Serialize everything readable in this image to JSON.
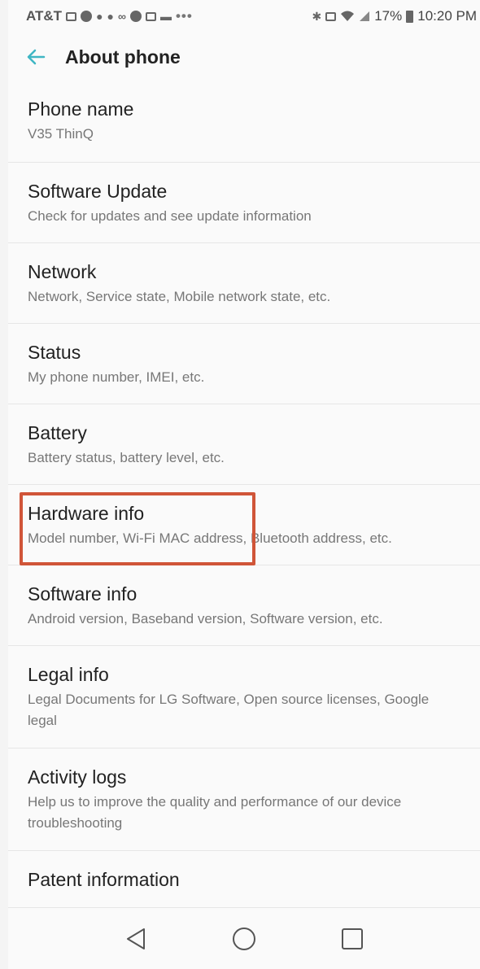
{
  "status_bar": {
    "carrier": "AT&T",
    "battery_percent": "17%",
    "time": "10:20 PM",
    "icons": [
      "message-icon",
      "whatsapp-icon",
      "app-icon",
      "app-icon",
      "voicemail-icon",
      "chrome-icon",
      "gallery-icon",
      "app-icon",
      "more-dots",
      "bluetooth-icon",
      "nfc-icon",
      "wifi-icon",
      "signal-icon",
      "battery-icon"
    ]
  },
  "header": {
    "title": "About phone"
  },
  "items": [
    {
      "title": "Phone name",
      "subtitle": "V35 ThinQ"
    },
    {
      "title": "Software Update",
      "subtitle": "Check for updates and see update information"
    },
    {
      "title": "Network",
      "subtitle": "Network, Service state, Mobile network state, etc."
    },
    {
      "title": "Status",
      "subtitle": "My phone number, IMEI, etc."
    },
    {
      "title": "Battery",
      "subtitle": "Battery status, battery level, etc."
    },
    {
      "title": "Hardware info",
      "subtitle": "Model number, Wi-Fi MAC address, Bluetooth address, etc."
    },
    {
      "title": "Software info",
      "subtitle": "Android version, Baseband version, Software version, etc."
    },
    {
      "title": "Legal info",
      "subtitle": "Legal Documents for LG Software, Open source licenses, Google legal"
    },
    {
      "title": "Activity logs",
      "subtitle": "Help us to improve the quality and performance of our device troubleshooting"
    },
    {
      "title": "Patent information",
      "subtitle": ""
    }
  ],
  "highlighted_item": "Hardware info",
  "colors": {
    "accent": "#3fb6c4",
    "highlight_box": "#d05538",
    "background": "#fafafa"
  }
}
